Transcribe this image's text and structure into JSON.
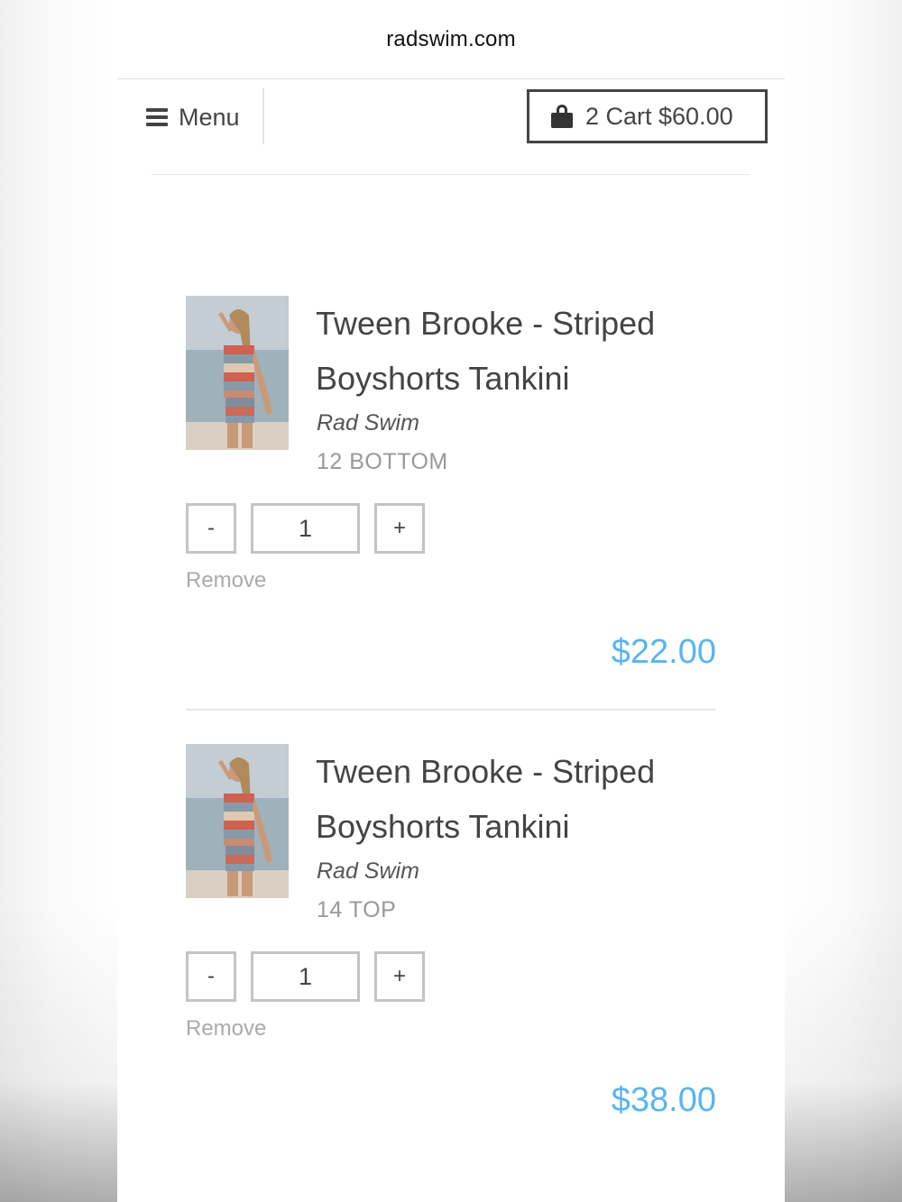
{
  "browser": {
    "url": "radswim.com"
  },
  "header": {
    "menu_label": "Menu",
    "cart_label": "2 Cart $60.00"
  },
  "cart": {
    "items": [
      {
        "title": "Tween Brooke - Striped Boyshorts Tankini",
        "vendor": "Rad Swim",
        "variant": "12 BOTTOM",
        "minus_label": "-",
        "quantity": "1",
        "plus_label": "+",
        "remove_label": "Remove",
        "price": "$22.00"
      },
      {
        "title": "Tween Brooke - Striped Boyshorts Tankini",
        "vendor": "Rad Swim",
        "variant": "14 TOP",
        "minus_label": "-",
        "quantity": "1",
        "plus_label": "+",
        "remove_label": "Remove",
        "price": "$38.00"
      }
    ]
  },
  "colors": {
    "price": "#5ab4f0",
    "text": "#444444",
    "border": "#c4c4c4"
  },
  "icons": [
    "hamburger-icon",
    "shopping-bag-icon"
  ]
}
